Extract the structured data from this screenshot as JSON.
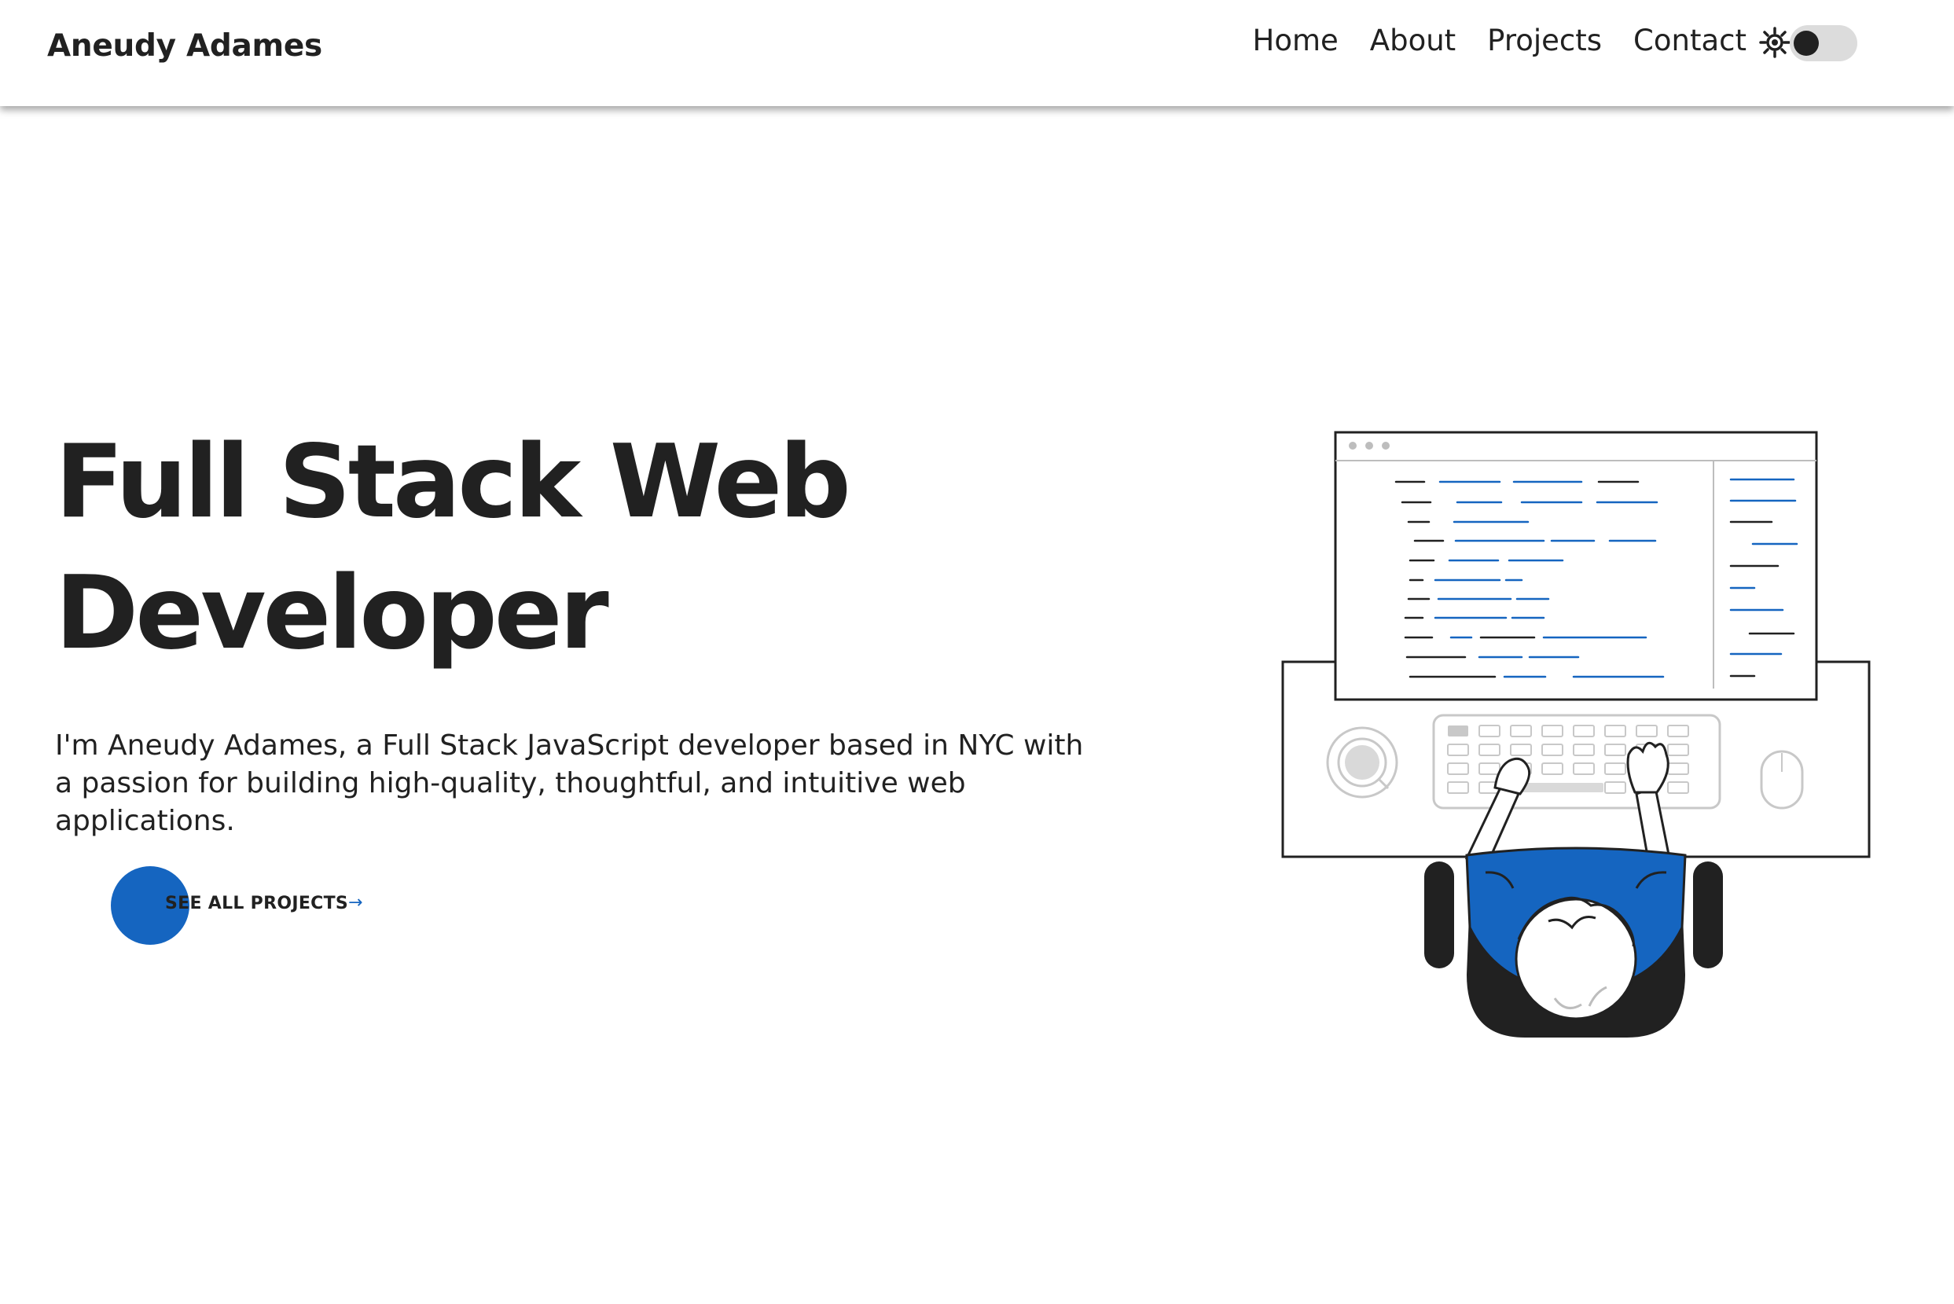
{
  "header": {
    "brand": "Aneudy Adames",
    "nav": [
      "Home",
      "About",
      "Projects",
      "Contact"
    ],
    "theme_icon": "sun-icon",
    "theme_toggle": "off"
  },
  "hero": {
    "title": "Full Stack Web Developer",
    "description": "I'm Aneudy Adames, a Full Stack JavaScript developer based in NYC with a passion for building high-quality, thoughtful, and intuitive web applications.",
    "cta_label": "SEE ALL PROJECTS",
    "cta_icon": "arrow-right-icon",
    "illustration": "developer-at-desk-illustration"
  },
  "colors": {
    "accent": "#1565c0",
    "text": "#212121",
    "background": "#ffffff"
  }
}
